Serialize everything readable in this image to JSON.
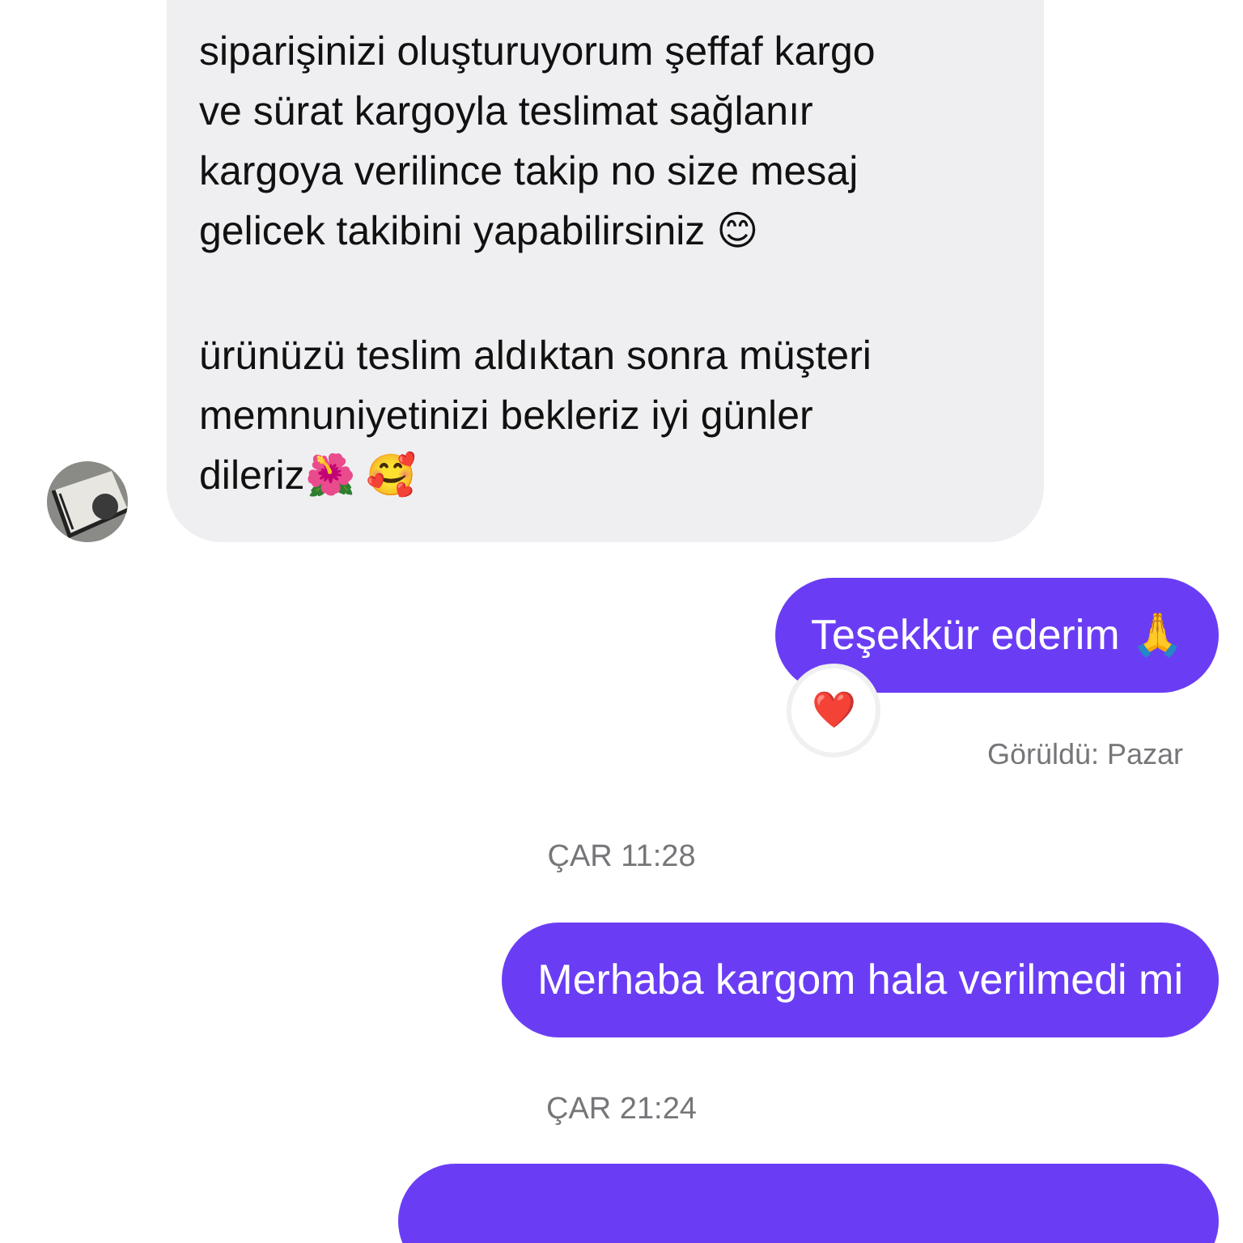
{
  "messages": [
    {
      "kind": "received",
      "paragraphs": [
        "siparişinizi oluşturuyorum şeffaf kargo\nve sürat kargoyla teslimat sağlanır\nkargoya verilince takip no size mesaj\ngelicek takibini yapabilirsiniz 😊",
        "ürünüzü teslim aldıktan sonra müşteri\nmemnuniyetinizi bekleriz iyi günler\ndileriz🌺 🥰"
      ],
      "avatar": true
    },
    {
      "kind": "sent",
      "text": "Teşekkür ederim 🙏",
      "reaction": "❤️"
    },
    {
      "kind": "status",
      "text": "Görüldü: Pazar"
    },
    {
      "kind": "time",
      "text": "ÇAR 11:28"
    },
    {
      "kind": "sent",
      "text": "Merhaba kargom hala verilmedi mi"
    },
    {
      "kind": "time",
      "text": "ÇAR 21:24"
    },
    {
      "kind": "sent_cut"
    }
  ]
}
